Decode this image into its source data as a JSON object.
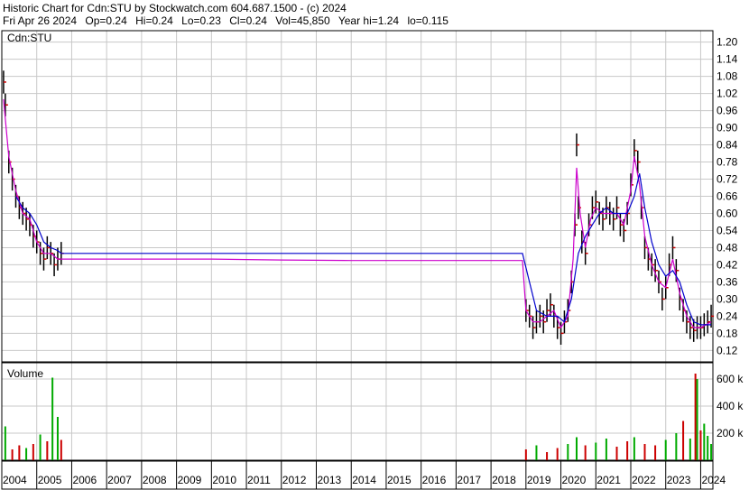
{
  "header": {
    "line1": "Historic Chart for Cdn:STU by Stockwatch.com 604.687.1500 - (c) 2024",
    "date": "Fri Apr 26 2024",
    "open": "Op=0.24",
    "high": "Hi=0.24",
    "low": "Lo=0.23",
    "close": "Cl=0.24",
    "volume": "Vol=45,850",
    "year_hi": "Year hi=1.24",
    "year_lo": "lo=0.115"
  },
  "chart_data": {
    "type": "line",
    "price_panel": {
      "label": "Cdn:STU",
      "ylim": [
        0.08,
        1.24
      ],
      "yticks": [
        "1.20",
        "1.14",
        "1.08",
        "1.02",
        "0.96",
        "0.90",
        "0.84",
        "0.78",
        "0.72",
        "0.66",
        "0.60",
        "0.54",
        "0.48",
        "0.42",
        "0.36",
        "0.30",
        "0.24",
        "0.18",
        "0.12"
      ],
      "x_range": [
        2004.0,
        2024.35
      ],
      "series": [
        {
          "color": "#cc0000",
          "style": "bar",
          "points": [
            [
              2004.05,
              1.06
            ],
            [
              2004.1,
              0.98
            ],
            [
              2004.2,
              0.78
            ],
            [
              2004.3,
              0.72
            ],
            [
              2004.4,
              0.66
            ],
            [
              2004.5,
              0.62
            ],
            [
              2004.6,
              0.6
            ],
            [
              2004.7,
              0.58
            ],
            [
              2004.8,
              0.56
            ],
            [
              2004.9,
              0.52
            ],
            [
              2005.0,
              0.5
            ],
            [
              2005.1,
              0.46
            ],
            [
              2005.2,
              0.44
            ],
            [
              2005.3,
              0.48
            ],
            [
              2005.4,
              0.46
            ],
            [
              2005.5,
              0.42
            ],
            [
              2005.6,
              0.44
            ],
            [
              2005.7,
              0.46
            ],
            [
              2019.0,
              0.26
            ],
            [
              2019.1,
              0.24
            ],
            [
              2019.2,
              0.2
            ],
            [
              2019.3,
              0.22
            ],
            [
              2019.4,
              0.24
            ],
            [
              2019.5,
              0.22
            ],
            [
              2019.6,
              0.26
            ],
            [
              2019.7,
              0.28
            ],
            [
              2019.8,
              0.24
            ],
            [
              2019.9,
              0.2
            ],
            [
              2020.0,
              0.18
            ],
            [
              2020.1,
              0.22
            ],
            [
              2020.2,
              0.26
            ],
            [
              2020.3,
              0.36
            ],
            [
              2020.4,
              0.56
            ],
            [
              2020.45,
              0.84
            ],
            [
              2020.5,
              0.62
            ],
            [
              2020.6,
              0.5
            ],
            [
              2020.7,
              0.46
            ],
            [
              2020.8,
              0.56
            ],
            [
              2020.9,
              0.62
            ],
            [
              2021.0,
              0.64
            ],
            [
              2021.1,
              0.6
            ],
            [
              2021.2,
              0.58
            ],
            [
              2021.3,
              0.62
            ],
            [
              2021.4,
              0.6
            ],
            [
              2021.5,
              0.58
            ],
            [
              2021.6,
              0.62
            ],
            [
              2021.7,
              0.56
            ],
            [
              2021.8,
              0.54
            ],
            [
              2021.9,
              0.6
            ],
            [
              2022.0,
              0.7
            ],
            [
              2022.1,
              0.82
            ],
            [
              2022.2,
              0.78
            ],
            [
              2022.3,
              0.62
            ],
            [
              2022.4,
              0.48
            ],
            [
              2022.5,
              0.44
            ],
            [
              2022.6,
              0.42
            ],
            [
              2022.7,
              0.4
            ],
            [
              2022.8,
              0.36
            ],
            [
              2022.9,
              0.3
            ],
            [
              2023.0,
              0.34
            ],
            [
              2023.1,
              0.42
            ],
            [
              2023.2,
              0.48
            ],
            [
              2023.3,
              0.4
            ],
            [
              2023.4,
              0.3
            ],
            [
              2023.5,
              0.26
            ],
            [
              2023.6,
              0.22
            ],
            [
              2023.7,
              0.2
            ],
            [
              2023.8,
              0.19
            ],
            [
              2023.9,
              0.2
            ],
            [
              2024.0,
              0.2
            ],
            [
              2024.1,
              0.21
            ],
            [
              2024.2,
              0.22
            ],
            [
              2024.3,
              0.24
            ]
          ]
        },
        {
          "color": "#cc00cc",
          "style": "line",
          "points": [
            [
              2004.05,
              1.0
            ],
            [
              2004.2,
              0.8
            ],
            [
              2004.4,
              0.68
            ],
            [
              2004.6,
              0.6
            ],
            [
              2004.8,
              0.58
            ],
            [
              2005.0,
              0.5
            ],
            [
              2005.2,
              0.46
            ],
            [
              2005.4,
              0.46
            ],
            [
              2005.6,
              0.44
            ],
            [
              2005.7,
              0.44
            ],
            [
              2010.0,
              0.44
            ],
            [
              2012.0,
              0.437
            ],
            [
              2014.0,
              0.435
            ],
            [
              2016.0,
              0.435
            ],
            [
              2018.0,
              0.435
            ],
            [
              2018.9,
              0.435
            ],
            [
              2019.0,
              0.26
            ],
            [
              2019.2,
              0.22
            ],
            [
              2019.4,
              0.22
            ],
            [
              2019.6,
              0.24
            ],
            [
              2019.8,
              0.26
            ],
            [
              2020.0,
              0.2
            ],
            [
              2020.2,
              0.24
            ],
            [
              2020.35,
              0.44
            ],
            [
              2020.45,
              0.76
            ],
            [
              2020.55,
              0.6
            ],
            [
              2020.7,
              0.48
            ],
            [
              2020.85,
              0.58
            ],
            [
              2021.0,
              0.62
            ],
            [
              2021.2,
              0.6
            ],
            [
              2021.4,
              0.6
            ],
            [
              2021.6,
              0.6
            ],
            [
              2021.8,
              0.56
            ],
            [
              2022.0,
              0.68
            ],
            [
              2022.1,
              0.8
            ],
            [
              2022.25,
              0.7
            ],
            [
              2022.4,
              0.52
            ],
            [
              2022.6,
              0.42
            ],
            [
              2022.8,
              0.36
            ],
            [
              2023.0,
              0.34
            ],
            [
              2023.2,
              0.44
            ],
            [
              2023.4,
              0.32
            ],
            [
              2023.6,
              0.24
            ],
            [
              2023.8,
              0.2
            ],
            [
              2024.0,
              0.2
            ],
            [
              2024.3,
              0.22
            ]
          ]
        },
        {
          "color": "#0000cc",
          "style": "line",
          "points": [
            [
              2004.4,
              0.66
            ],
            [
              2004.6,
              0.62
            ],
            [
              2004.8,
              0.6
            ],
            [
              2005.0,
              0.56
            ],
            [
              2005.2,
              0.5
            ],
            [
              2005.4,
              0.48
            ],
            [
              2005.6,
              0.47
            ],
            [
              2005.7,
              0.46
            ],
            [
              2010.0,
              0.46
            ],
            [
              2014.0,
              0.46
            ],
            [
              2018.0,
              0.46
            ],
            [
              2018.9,
              0.46
            ],
            [
              2019.1,
              0.36
            ],
            [
              2019.3,
              0.26
            ],
            [
              2019.6,
              0.24
            ],
            [
              2019.9,
              0.24
            ],
            [
              2020.1,
              0.22
            ],
            [
              2020.3,
              0.3
            ],
            [
              2020.5,
              0.46
            ],
            [
              2020.7,
              0.52
            ],
            [
              2020.9,
              0.56
            ],
            [
              2021.1,
              0.6
            ],
            [
              2021.3,
              0.62
            ],
            [
              2021.5,
              0.6
            ],
            [
              2021.7,
              0.6
            ],
            [
              2021.9,
              0.6
            ],
            [
              2022.1,
              0.66
            ],
            [
              2022.25,
              0.74
            ],
            [
              2022.4,
              0.62
            ],
            [
              2022.6,
              0.5
            ],
            [
              2022.8,
              0.42
            ],
            [
              2023.0,
              0.38
            ],
            [
              2023.2,
              0.4
            ],
            [
              2023.4,
              0.36
            ],
            [
              2023.6,
              0.28
            ],
            [
              2023.8,
              0.22
            ],
            [
              2024.0,
              0.21
            ],
            [
              2024.3,
              0.21
            ]
          ]
        }
      ]
    },
    "volume_panel": {
      "label": "Volume",
      "ylim": [
        0,
        720000
      ],
      "yticks": [
        {
          "label": "600 k",
          "value": 600000
        },
        {
          "label": "400 k",
          "value": 400000
        },
        {
          "label": "200 k",
          "value": 200000
        }
      ],
      "bars": [
        {
          "x": 2004.1,
          "value": 250000,
          "color": "#00aa00"
        },
        {
          "x": 2004.3,
          "value": 80000,
          "color": "#cc0000"
        },
        {
          "x": 2004.5,
          "value": 110000,
          "color": "#cc0000"
        },
        {
          "x": 2004.7,
          "value": 90000,
          "color": "#00aa00"
        },
        {
          "x": 2004.9,
          "value": 120000,
          "color": "#cc0000"
        },
        {
          "x": 2005.1,
          "value": 190000,
          "color": "#00aa00"
        },
        {
          "x": 2005.3,
          "value": 140000,
          "color": "#cc0000"
        },
        {
          "x": 2005.45,
          "value": 610000,
          "color": "#00aa00"
        },
        {
          "x": 2005.6,
          "value": 320000,
          "color": "#00aa00"
        },
        {
          "x": 2005.7,
          "value": 150000,
          "color": "#cc0000"
        },
        {
          "x": 2019.0,
          "value": 80000,
          "color": "#cc0000"
        },
        {
          "x": 2019.3,
          "value": 110000,
          "color": "#00aa00"
        },
        {
          "x": 2019.6,
          "value": 60000,
          "color": "#cc0000"
        },
        {
          "x": 2019.9,
          "value": 90000,
          "color": "#cc0000"
        },
        {
          "x": 2020.2,
          "value": 120000,
          "color": "#00aa00"
        },
        {
          "x": 2020.45,
          "value": 170000,
          "color": "#00aa00"
        },
        {
          "x": 2020.7,
          "value": 110000,
          "color": "#cc0000"
        },
        {
          "x": 2021.0,
          "value": 130000,
          "color": "#00aa00"
        },
        {
          "x": 2021.3,
          "value": 160000,
          "color": "#00aa00"
        },
        {
          "x": 2021.6,
          "value": 100000,
          "color": "#cc0000"
        },
        {
          "x": 2021.9,
          "value": 140000,
          "color": "#cc0000"
        },
        {
          "x": 2022.1,
          "value": 170000,
          "color": "#00aa00"
        },
        {
          "x": 2022.4,
          "value": 120000,
          "color": "#cc0000"
        },
        {
          "x": 2022.7,
          "value": 110000,
          "color": "#cc0000"
        },
        {
          "x": 2023.0,
          "value": 150000,
          "color": "#00aa00"
        },
        {
          "x": 2023.3,
          "value": 200000,
          "color": "#00aa00"
        },
        {
          "x": 2023.5,
          "value": 290000,
          "color": "#cc0000"
        },
        {
          "x": 2023.7,
          "value": 160000,
          "color": "#00aa00"
        },
        {
          "x": 2023.85,
          "value": 640000,
          "color": "#cc0000"
        },
        {
          "x": 2023.9,
          "value": 600000,
          "color": "#00aa00"
        },
        {
          "x": 2024.0,
          "value": 220000,
          "color": "#cc0000"
        },
        {
          "x": 2024.1,
          "value": 270000,
          "color": "#00aa00"
        },
        {
          "x": 2024.2,
          "value": 180000,
          "color": "#00aa00"
        },
        {
          "x": 2024.3,
          "value": 120000,
          "color": "#00aa00"
        }
      ]
    },
    "x_axis": {
      "years": [
        "2004",
        "2005",
        "2006",
        "2007",
        "2008",
        "2009",
        "2010",
        "2011",
        "2012",
        "2013",
        "2014",
        "2015",
        "2016",
        "2017",
        "2018",
        "2019",
        "2020",
        "2021",
        "2022",
        "2023",
        "2024"
      ],
      "year_starts": [
        2004,
        2005,
        2006,
        2007,
        2008,
        2009,
        2010,
        2011,
        2012,
        2013,
        2014,
        2015,
        2016,
        2017,
        2018,
        2019,
        2020,
        2021,
        2022,
        2023,
        2024
      ]
    },
    "grid": true,
    "colors": {
      "bar_color": "#cc0000",
      "ma_short": "#cc00cc",
      "ma_long": "#0000cc",
      "vol_up": "#00aa00",
      "vol_down": "#cc0000",
      "grid": "#c8c8c8"
    }
  }
}
